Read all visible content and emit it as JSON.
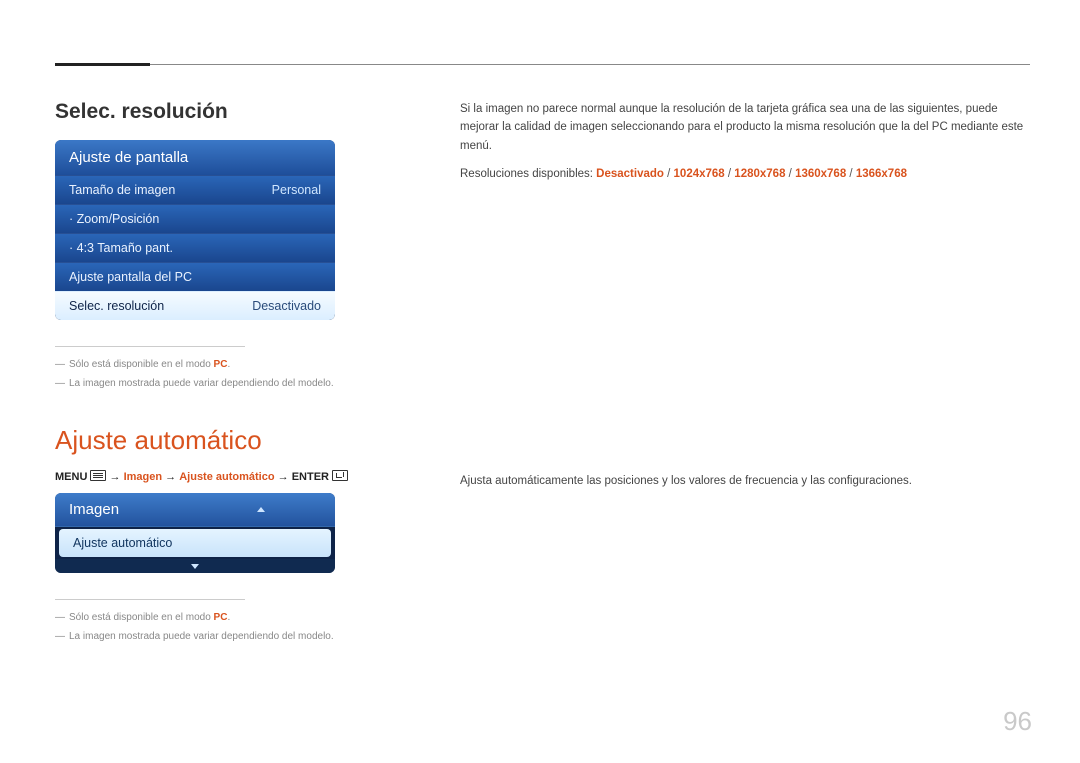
{
  "page_number": "96",
  "section1": {
    "heading": "Selec. resolución",
    "panel_title": "Ajuste de pantalla",
    "rows": [
      {
        "label": "Tamaño de imagen",
        "value": "Personal"
      },
      {
        "label": "· Zoom/Posición",
        "value": ""
      },
      {
        "label": "· 4:3 Tamaño pant.",
        "value": ""
      },
      {
        "label": "Ajuste pantalla del PC",
        "value": ""
      },
      {
        "label": "Selec. resolución",
        "value": "Desactivado"
      }
    ],
    "note1_prefix": "Sólo está disponible en el modo ",
    "note1_bold": "PC",
    "note1_suffix": ".",
    "note2": "La imagen mostrada puede variar dependiendo del modelo.",
    "body1": "Si la imagen no parece normal aunque la resolución de la tarjeta gráfica sea una de las siguientes, puede mejorar la calidad de imagen seleccionando para el producto la misma resolución que la del PC mediante este menú.",
    "res_label": "Resoluciones disponibles: ",
    "res_options": [
      "Desactivado",
      "1024x768",
      "1280x768",
      "1360x768",
      "1366x768"
    ],
    "sep": " / "
  },
  "section2": {
    "heading": "Ajuste automático",
    "path": {
      "menu": "MENU",
      "arrow": " → ",
      "p1": "Imagen",
      "p2": "Ajuste automático",
      "enter": "ENTER"
    },
    "panel_title": "Imagen",
    "row_label": "Ajuste automático",
    "note1_prefix": "Sólo está disponible en el modo ",
    "note1_bold": "PC",
    "note1_suffix": ".",
    "note2": "La imagen mostrada puede variar dependiendo del modelo.",
    "body": "Ajusta automáticamente las posiciones y los valores de frecuencia y las configuraciones."
  }
}
